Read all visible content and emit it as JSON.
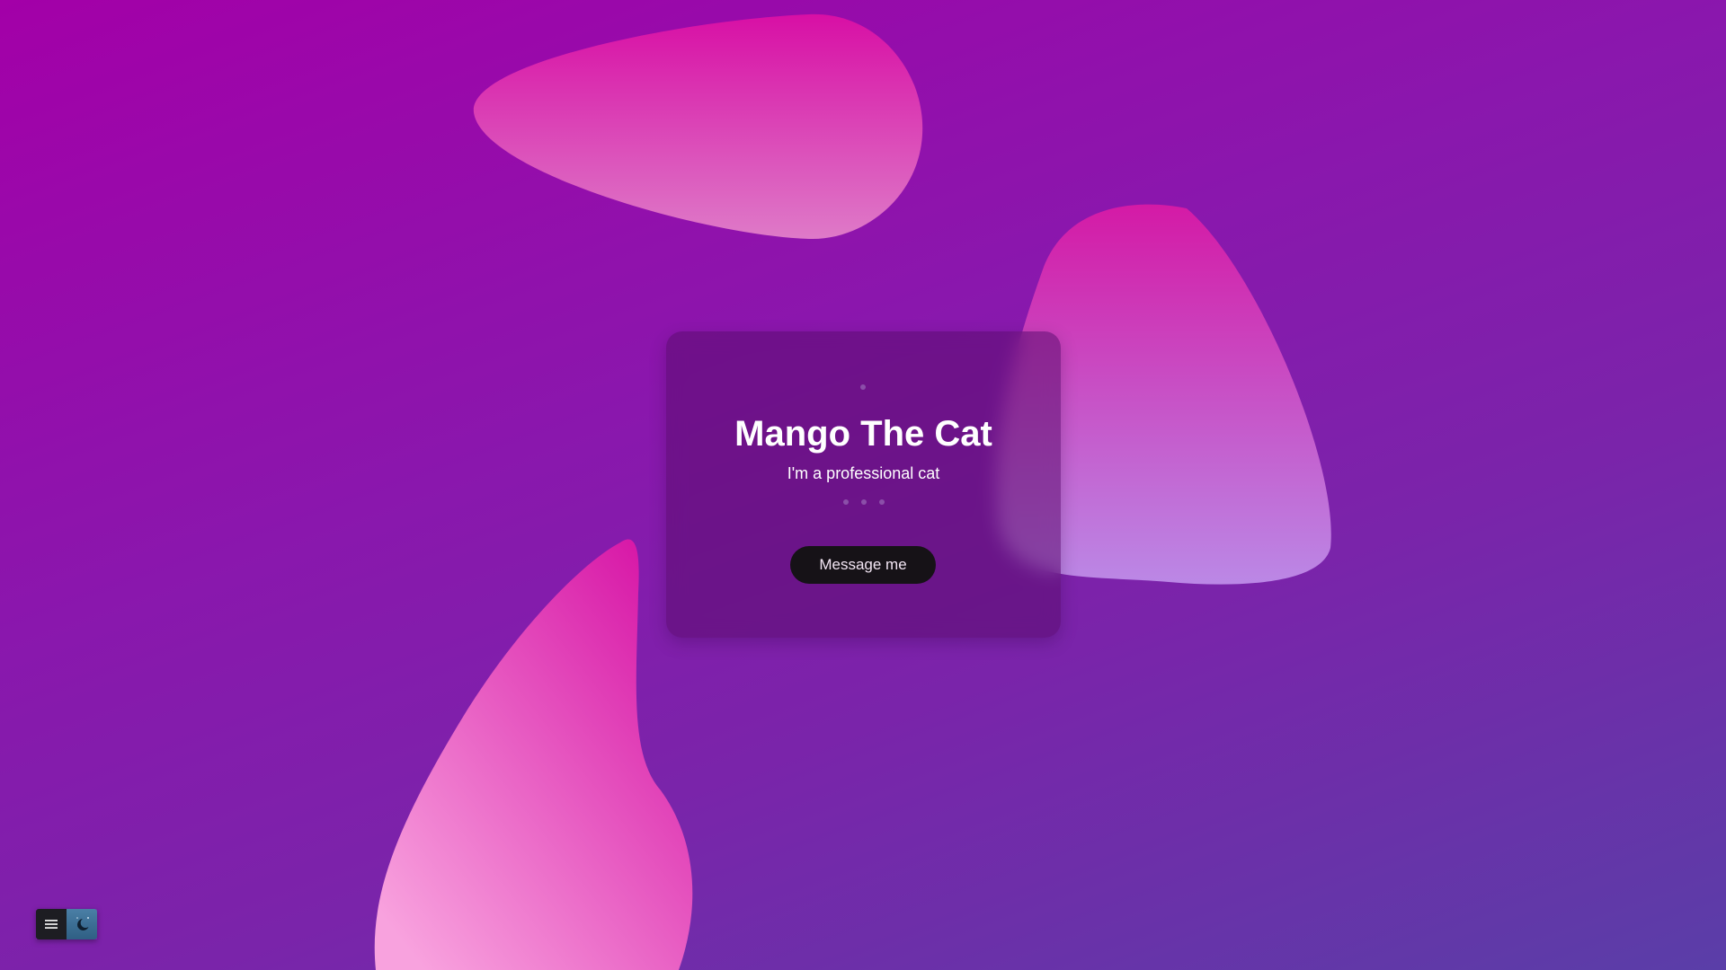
{
  "profile": {
    "name": "Mango The Cat",
    "tagline": "I'm a professional cat",
    "message_button_label": "Message me"
  },
  "toolbar": {
    "menu_icon": "menu-icon",
    "theme_icon": "moon-icon"
  },
  "colors": {
    "background_start": "#a300a8",
    "background_end": "#5a3ea8",
    "blob_pink": "#d80fa0",
    "blob_light": "#f6a4e0",
    "button_bg": "#161217"
  }
}
